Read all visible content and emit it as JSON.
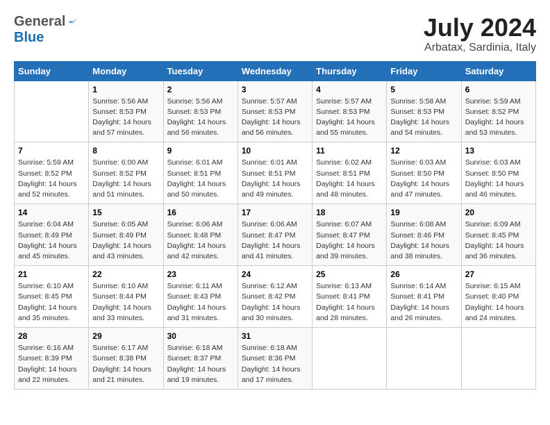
{
  "header": {
    "logo_general": "General",
    "logo_blue": "Blue",
    "title": "July 2024",
    "subtitle": "Arbatax, Sardinia, Italy"
  },
  "days_of_week": [
    "Sunday",
    "Monday",
    "Tuesday",
    "Wednesday",
    "Thursday",
    "Friday",
    "Saturday"
  ],
  "weeks": [
    [
      {
        "day": "",
        "info": ""
      },
      {
        "day": "1",
        "info": "Sunrise: 5:56 AM\nSunset: 8:53 PM\nDaylight: 14 hours\nand 57 minutes."
      },
      {
        "day": "2",
        "info": "Sunrise: 5:56 AM\nSunset: 8:53 PM\nDaylight: 14 hours\nand 56 minutes."
      },
      {
        "day": "3",
        "info": "Sunrise: 5:57 AM\nSunset: 8:53 PM\nDaylight: 14 hours\nand 56 minutes."
      },
      {
        "day": "4",
        "info": "Sunrise: 5:57 AM\nSunset: 8:53 PM\nDaylight: 14 hours\nand 55 minutes."
      },
      {
        "day": "5",
        "info": "Sunrise: 5:58 AM\nSunset: 8:53 PM\nDaylight: 14 hours\nand 54 minutes."
      },
      {
        "day": "6",
        "info": "Sunrise: 5:59 AM\nSunset: 8:52 PM\nDaylight: 14 hours\nand 53 minutes."
      }
    ],
    [
      {
        "day": "7",
        "info": "Sunrise: 5:59 AM\nSunset: 8:52 PM\nDaylight: 14 hours\nand 52 minutes."
      },
      {
        "day": "8",
        "info": "Sunrise: 6:00 AM\nSunset: 8:52 PM\nDaylight: 14 hours\nand 51 minutes."
      },
      {
        "day": "9",
        "info": "Sunrise: 6:01 AM\nSunset: 8:51 PM\nDaylight: 14 hours\nand 50 minutes."
      },
      {
        "day": "10",
        "info": "Sunrise: 6:01 AM\nSunset: 8:51 PM\nDaylight: 14 hours\nand 49 minutes."
      },
      {
        "day": "11",
        "info": "Sunrise: 6:02 AM\nSunset: 8:51 PM\nDaylight: 14 hours\nand 48 minutes."
      },
      {
        "day": "12",
        "info": "Sunrise: 6:03 AM\nSunset: 8:50 PM\nDaylight: 14 hours\nand 47 minutes."
      },
      {
        "day": "13",
        "info": "Sunrise: 6:03 AM\nSunset: 8:50 PM\nDaylight: 14 hours\nand 46 minutes."
      }
    ],
    [
      {
        "day": "14",
        "info": "Sunrise: 6:04 AM\nSunset: 8:49 PM\nDaylight: 14 hours\nand 45 minutes."
      },
      {
        "day": "15",
        "info": "Sunrise: 6:05 AM\nSunset: 8:49 PM\nDaylight: 14 hours\nand 43 minutes."
      },
      {
        "day": "16",
        "info": "Sunrise: 6:06 AM\nSunset: 8:48 PM\nDaylight: 14 hours\nand 42 minutes."
      },
      {
        "day": "17",
        "info": "Sunrise: 6:06 AM\nSunset: 8:47 PM\nDaylight: 14 hours\nand 41 minutes."
      },
      {
        "day": "18",
        "info": "Sunrise: 6:07 AM\nSunset: 8:47 PM\nDaylight: 14 hours\nand 39 minutes."
      },
      {
        "day": "19",
        "info": "Sunrise: 6:08 AM\nSunset: 8:46 PM\nDaylight: 14 hours\nand 38 minutes."
      },
      {
        "day": "20",
        "info": "Sunrise: 6:09 AM\nSunset: 8:45 PM\nDaylight: 14 hours\nand 36 minutes."
      }
    ],
    [
      {
        "day": "21",
        "info": "Sunrise: 6:10 AM\nSunset: 8:45 PM\nDaylight: 14 hours\nand 35 minutes."
      },
      {
        "day": "22",
        "info": "Sunrise: 6:10 AM\nSunset: 8:44 PM\nDaylight: 14 hours\nand 33 minutes."
      },
      {
        "day": "23",
        "info": "Sunrise: 6:11 AM\nSunset: 8:43 PM\nDaylight: 14 hours\nand 31 minutes."
      },
      {
        "day": "24",
        "info": "Sunrise: 6:12 AM\nSunset: 8:42 PM\nDaylight: 14 hours\nand 30 minutes."
      },
      {
        "day": "25",
        "info": "Sunrise: 6:13 AM\nSunset: 8:41 PM\nDaylight: 14 hours\nand 28 minutes."
      },
      {
        "day": "26",
        "info": "Sunrise: 6:14 AM\nSunset: 8:41 PM\nDaylight: 14 hours\nand 26 minutes."
      },
      {
        "day": "27",
        "info": "Sunrise: 6:15 AM\nSunset: 8:40 PM\nDaylight: 14 hours\nand 24 minutes."
      }
    ],
    [
      {
        "day": "28",
        "info": "Sunrise: 6:16 AM\nSunset: 8:39 PM\nDaylight: 14 hours\nand 22 minutes."
      },
      {
        "day": "29",
        "info": "Sunrise: 6:17 AM\nSunset: 8:38 PM\nDaylight: 14 hours\nand 21 minutes."
      },
      {
        "day": "30",
        "info": "Sunrise: 6:18 AM\nSunset: 8:37 PM\nDaylight: 14 hours\nand 19 minutes."
      },
      {
        "day": "31",
        "info": "Sunrise: 6:18 AM\nSunset: 8:36 PM\nDaylight: 14 hours\nand 17 minutes."
      },
      {
        "day": "",
        "info": ""
      },
      {
        "day": "",
        "info": ""
      },
      {
        "day": "",
        "info": ""
      }
    ]
  ]
}
